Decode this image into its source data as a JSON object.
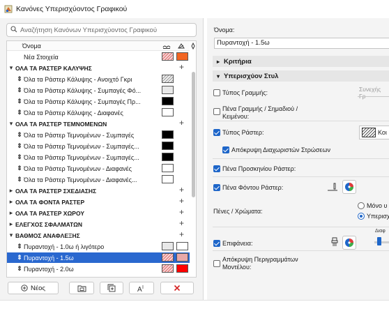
{
  "window": {
    "title": "Κανόνες Υπερισχύοντος Γραφικού"
  },
  "search": {
    "placeholder": "Αναζήτηση Κανόνων Υπερισχύοντος Γραφικού"
  },
  "list": {
    "header_name": "Όνομα",
    "new_items_label": "Νέα Στοιχεία",
    "groups": [
      {
        "name": "ΟΛΑ ΤΑ ΡΑΣΤΕΡ ΚΑΛΥΨΗΣ"
      },
      {
        "name": "ΟΛΑ ΤΑ ΡΑΣΤΕΡ ΤΕΜΝΟΜΕΝΩΝ"
      },
      {
        "name": "ΟΛΑ ΤΑ ΡΑΣΤΕΡ ΣΧΕΔΙΑΣΗΣ"
      },
      {
        "name": "ΟΛΑ ΤΑ ΦΟΝΤΑ ΡΑΣΤΕΡ"
      },
      {
        "name": "ΟΛΑ ΤΑ ΡΑΣΤΕΡ ΧΩΡΟΥ"
      },
      {
        "name": "ΕΛΕΓΧΟΣ ΣΦΑΛΜΑΤΩΝ"
      },
      {
        "name": "ΒΑΘΜΟΣ ΑΝΑΦΛΕΞΗΣ"
      }
    ],
    "items": [
      {
        "label": "Όλα τα Ράστερ Κάλυψης - Ανοιχτό Γκρι"
      },
      {
        "label": "Όλα τα Ράστερ Κάλυψης - Συμπαγές Φό..."
      },
      {
        "label": "Όλα τα Ράστερ Κάλυψης - Συμπαγές Πρ..."
      },
      {
        "label": "Όλα τα Ράστερ Κάλυψης - Διαφανές"
      },
      {
        "label": "Όλα τα Ράστερ Τεμνομένων - Συμπαγές"
      },
      {
        "label": "Όλα τα Ράστερ Τεμνομένων - Συμπαγές..."
      },
      {
        "label": "Όλα τα Ράστερ Τεμνομένων - Συμπαγές..."
      },
      {
        "label": "Όλα τα Ράστερ Τεμνομένων - Διαφανές"
      },
      {
        "label": "Όλα τα Ράστερ Τεμνομένων - Διαφανές..."
      },
      {
        "label": "Πυραντοχή - 1.0ω ή λιγότερο"
      },
      {
        "label": "Πυραντοχή - 1.5ω"
      },
      {
        "label": "Πυραντοχή - 2.0ω"
      }
    ]
  },
  "buttons": {
    "new": "Νέος"
  },
  "details": {
    "name_label": "Όνομα:",
    "name_value": "Πυραντοχή - 1.5ω",
    "criteria": "Κριτήρια",
    "override_style": "Υπερισχύον Στυλ",
    "line_type": "Τύπος Γραμμής:",
    "line_type_value": "Συνεχής Γρ",
    "line_pen": "Πένα Γραμμής / Σημαδιού / Κειμένου:",
    "fill_type": "Τύπος Ράστερ:",
    "fill_type_value": "Κοι",
    "hide_separators": "Απόκρυψη Διαχωριστών Στρώσεων",
    "fill_fg_pen": "Πένα Προσκηνίου Ράστερ:",
    "fill_bg_pen": "Πένα Φόντου Ράστερ:",
    "pens_colors": "Πένες / Χρώματα:",
    "radio_1": "Μόνο υ",
    "radio_2": "Υπερισχ",
    "surface": "Επιφάνεια:",
    "transparency": "Διαφ",
    "hide_model_contours": "Απόκρυψη Περιγραμμάτων Μοντέλου:"
  },
  "colors": {
    "accent": "#2a68cf",
    "selected_row": "#2a68cf",
    "orange": "#f26522",
    "red": "#ff0000"
  }
}
